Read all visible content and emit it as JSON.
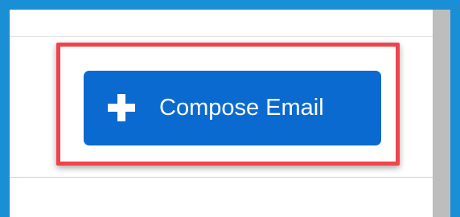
{
  "compose_button": {
    "label": "Compose Email",
    "icon": "plus-icon",
    "background_color": "#0b6acf"
  },
  "highlight": {
    "border_color": "#f0444a"
  },
  "frame": {
    "border_color": "#1a8fd6"
  }
}
